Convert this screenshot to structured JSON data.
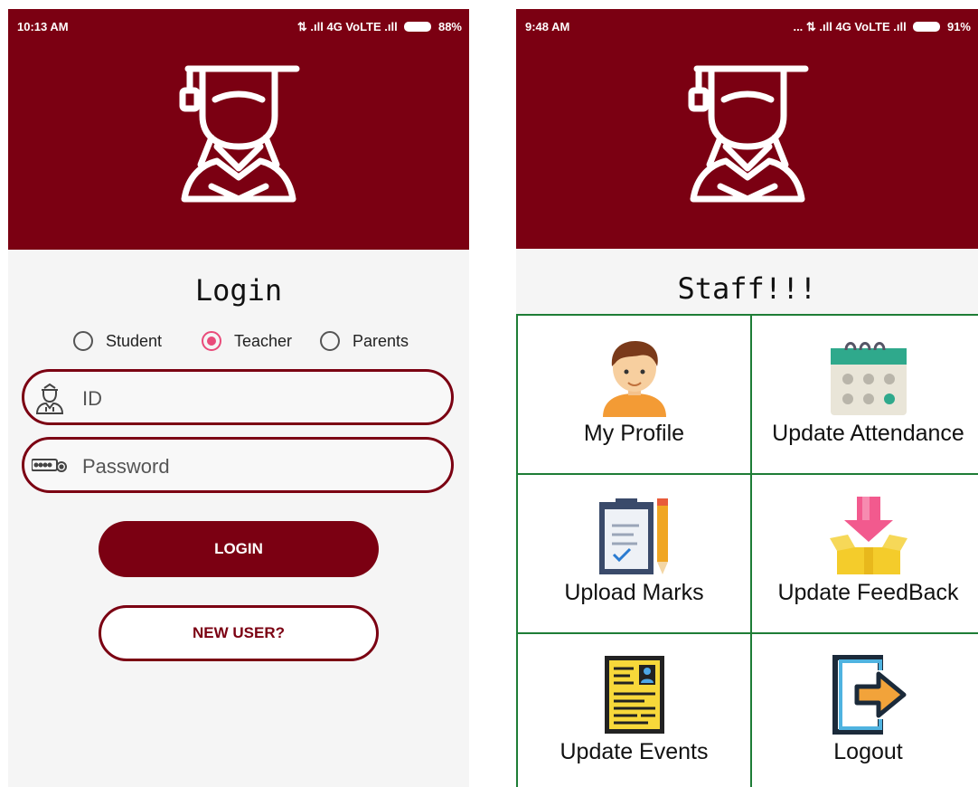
{
  "login_screen": {
    "status_bar": {
      "time": "10:13 AM",
      "indicators": "⇅ .ıll 4G VoLTE .ıll",
      "battery": "88%"
    },
    "logo_icon": "graduate-icon",
    "title": "Login",
    "roles": [
      {
        "label": "Student",
        "checked": false
      },
      {
        "label": "Teacher",
        "checked": true
      },
      {
        "label": "Parents",
        "checked": false
      }
    ],
    "id_field": {
      "placeholder": "ID",
      "icon": "user-icon"
    },
    "password_field": {
      "placeholder": "Password",
      "icon": "password-key-icon"
    },
    "login_button": "LOGIN",
    "new_user_button": "NEW USER?"
  },
  "staff_screen": {
    "status_bar": {
      "time": "9:48 AM",
      "indicators": "... ⇅ .ıll 4G VoLTE .ıll",
      "battery": "91%"
    },
    "logo_icon": "graduate-icon",
    "title": "Staff!!!",
    "menu": [
      {
        "label": "My Profile",
        "icon": "profile-avatar-icon"
      },
      {
        "label": "Update Attendance",
        "icon": "calendar-icon"
      },
      {
        "label": "Upload Marks",
        "icon": "clipboard-pencil-icon"
      },
      {
        "label": "Update FeedBack",
        "icon": "feedback-box-icon"
      },
      {
        "label": "Update Events",
        "icon": "events-document-icon"
      },
      {
        "label": "Logout",
        "icon": "logout-icon"
      }
    ]
  },
  "colors": {
    "brand": "#7b0012",
    "accent": "#e94b7a",
    "grid_border": "#1e7d36",
    "background": "#f5f5f5"
  }
}
